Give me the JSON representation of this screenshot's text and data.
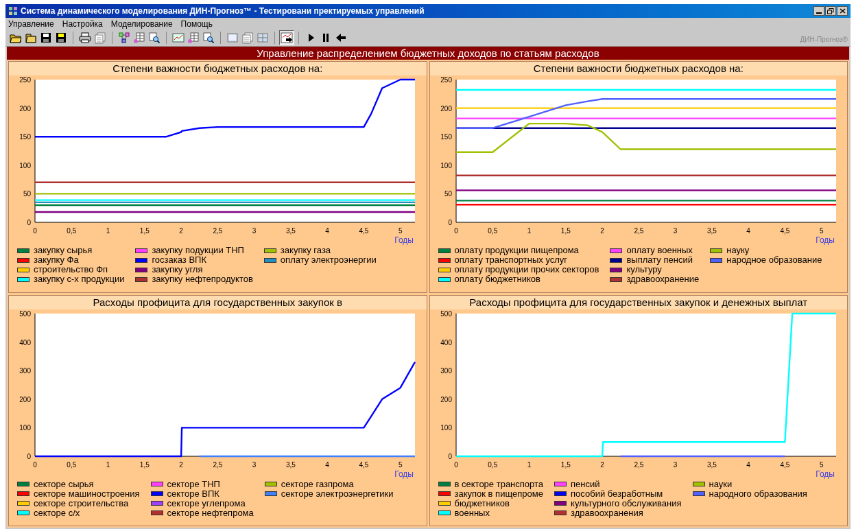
{
  "window": {
    "title": "Система динамического моделирования ДИН-Прогноз™ - Тестировани пректируемых управлений"
  },
  "menu": [
    "Управление",
    "Настройка",
    "Моделирование",
    "Помощь"
  ],
  "toolbar": [
    [
      {
        "kind": "open",
        "pressed": false
      },
      {
        "kind": "folder",
        "pressed": false
      },
      {
        "kind": "save",
        "pressed": false
      },
      {
        "kind": "saveas",
        "pressed": false
      }
    ],
    [
      {
        "kind": "print",
        "pressed": false
      },
      {
        "kind": "page",
        "pressed": false
      }
    ],
    [
      {
        "kind": "diagram",
        "pressed": false
      },
      {
        "kind": "table",
        "pressed": false
      },
      {
        "kind": "zoom",
        "pressed": false
      }
    ],
    [
      {
        "kind": "chart",
        "pressed": false
      },
      {
        "kind": "table",
        "pressed": false
      },
      {
        "kind": "zoom",
        "pressed": false
      }
    ],
    [
      {
        "kind": "window",
        "pressed": false
      },
      {
        "kind": "pages",
        "pressed": false
      },
      {
        "kind": "grid",
        "pressed": false
      }
    ],
    [
      {
        "kind": "run-chart",
        "pressed": true
      }
    ],
    [
      {
        "kind": "play",
        "pressed": false
      },
      {
        "kind": "pause",
        "pressed": false
      },
      {
        "kind": "back",
        "pressed": false
      }
    ]
  ],
  "brand": "ДИН-Прогноз®",
  "header": "Управление распределением бюджетных доходов по статьям расходов",
  "charts": [
    {
      "title": "Степени важности бюджетных расходов на:",
      "chart_data": {
        "type": "line",
        "xlabel": "Годы",
        "x": [
          0,
          0.5,
          1,
          1.5,
          1.8,
          2,
          2.01,
          2.25,
          2.5,
          3,
          3.5,
          4,
          4.5,
          4.6,
          4.75,
          5,
          5.2
        ],
        "xlim": [
          0,
          5.2
        ],
        "ylim": [
          0,
          250
        ],
        "yticks": [
          0,
          50,
          100,
          150,
          200,
          250
        ],
        "xticks": [
          0,
          {
            "value": 0.5,
            "label": "0,5"
          },
          1,
          {
            "value": 1.5,
            "label": "1,5"
          },
          2,
          {
            "value": 2.5,
            "label": "2,5"
          },
          3,
          {
            "value": 3.5,
            "label": "3,5"
          },
          4,
          {
            "value": 4.5,
            "label": "4,5"
          },
          5
        ],
        "series": [
          {
            "name": "закупку сырья",
            "color": "#008040",
            "values": [
              30,
              30,
              30,
              30,
              30,
              30,
              30,
              30,
              30,
              30,
              30,
              30,
              30,
              30,
              30,
              30,
              30
            ]
          },
          {
            "name": "закупку Фа",
            "color": "#ff0000",
            "values": [
              null,
              null,
              null,
              null,
              null,
              null,
              null,
              null,
              null,
              null,
              null,
              null,
              null,
              null,
              null,
              null,
              null
            ]
          },
          {
            "name": "строительство Фп",
            "color": "#ffcc00",
            "values": [
              null,
              null,
              null,
              null,
              null,
              null,
              null,
              null,
              null,
              null,
              null,
              null,
              null,
              null,
              null,
              null,
              null
            ]
          },
          {
            "name": "закупку с-х продукции",
            "color": "#00ffff",
            "values": [
              39,
              39,
              39,
              39,
              39,
              39,
              39,
              39,
              39,
              39,
              39,
              39,
              39,
              39,
              39,
              39,
              39
            ]
          },
          {
            "name": "закупку подукции ТНП",
            "color": "#ff40ff",
            "values": [
              null,
              null,
              null,
              null,
              null,
              null,
              null,
              null,
              null,
              null,
              null,
              null,
              null,
              null,
              null,
              null,
              null
            ]
          },
          {
            "name": "госзаказ ВПК",
            "color": "#0000ff",
            "values": [
              150,
              150,
              150,
              150,
              150,
              158,
              160,
              165,
              167,
              167,
              167,
              167,
              167,
              190,
              235,
              250,
              250
            ]
          },
          {
            "name": "закупку угля",
            "color": "#800080",
            "values": [
              18,
              18,
              18,
              18,
              18,
              18,
              18,
              18,
              18,
              18,
              18,
              18,
              18,
              18,
              18,
              18,
              18
            ]
          },
          {
            "name": "закупку нефтепродуктов",
            "color": "#b03030",
            "values": [
              70,
              70,
              70,
              70,
              70,
              70,
              70,
              70,
              70,
              70,
              70,
              70,
              70,
              70,
              70,
              70,
              70
            ]
          },
          {
            "name": "закупку газа",
            "color": "#a0c000",
            "values": [
              50,
              50,
              50,
              50,
              50,
              50,
              50,
              50,
              50,
              50,
              50,
              50,
              50,
              50,
              50,
              50,
              50
            ]
          },
          {
            "name": "оплату электроэнергии",
            "color": "#2090c0",
            "values": [
              35,
              35,
              35,
              35,
              35,
              35,
              35,
              35,
              35,
              35,
              35,
              35,
              35,
              35,
              35,
              35,
              35
            ]
          }
        ]
      }
    },
    {
      "title": "Степени важности бюджетных расходов на:",
      "chart_data": {
        "type": "line",
        "xlabel": "Годы",
        "x": [
          0,
          0.5,
          1,
          1.5,
          1.8,
          2,
          2.01,
          2.25,
          2.5,
          3,
          3.5,
          4,
          4.5,
          4.6,
          4.75,
          5,
          5.2
        ],
        "xlim": [
          0,
          5.2
        ],
        "ylim": [
          0,
          250
        ],
        "yticks": [
          0,
          50,
          100,
          150,
          200,
          250
        ],
        "xticks": [
          0,
          {
            "value": 0.5,
            "label": "0,5"
          },
          1,
          {
            "value": 1.5,
            "label": "1,5"
          },
          2,
          {
            "value": 2.5,
            "label": "2,5"
          },
          3,
          {
            "value": 3.5,
            "label": "3,5"
          },
          4,
          {
            "value": 4.5,
            "label": "4,5"
          },
          5
        ],
        "series": [
          {
            "name": "оплату продукции пищепрома",
            "color": "#008040",
            "values": [
              38,
              38,
              38,
              38,
              38,
              38,
              38,
              38,
              38,
              38,
              38,
              38,
              38,
              38,
              38,
              38,
              38
            ]
          },
          {
            "name": "оплату транспортных услуг",
            "color": "#ff0000",
            "values": [
              31,
              31,
              31,
              31,
              31,
              31,
              31,
              31,
              31,
              31,
              31,
              31,
              31,
              31,
              31,
              31,
              31
            ]
          },
          {
            "name": "оплату продукции прочих секторов",
            "color": "#ffcc00",
            "values": [
              200,
              200,
              200,
              200,
              200,
              200,
              200,
              200,
              200,
              200,
              200,
              200,
              200,
              200,
              200,
              200,
              200
            ]
          },
          {
            "name": "оплату бюджетников",
            "color": "#00ffff",
            "values": [
              232,
              232,
              232,
              232,
              232,
              232,
              232,
              232,
              232,
              232,
              232,
              232,
              232,
              232,
              232,
              232,
              232
            ]
          },
          {
            "name": "оплату военных",
            "color": "#ff40ff",
            "values": [
              182,
              182,
              182,
              182,
              182,
              182,
              182,
              182,
              182,
              182,
              182,
              182,
              182,
              182,
              182,
              182,
              182
            ]
          },
          {
            "name": "выплату пенсий",
            "color": "#000090",
            "values": [
              165,
              165,
              165,
              165,
              165,
              165,
              165,
              165,
              165,
              165,
              165,
              165,
              165,
              165,
              165,
              165,
              165
            ]
          },
          {
            "name": "культуру",
            "color": "#800080",
            "values": [
              56,
              56,
              56,
              56,
              56,
              56,
              56,
              56,
              56,
              56,
              56,
              56,
              56,
              56,
              56,
              56,
              56
            ]
          },
          {
            "name": "здравоохранение",
            "color": "#b03030",
            "values": [
              82,
              82,
              82,
              82,
              82,
              82,
              82,
              82,
              82,
              82,
              82,
              82,
              82,
              82,
              82,
              82,
              82
            ]
          },
          {
            "name": "науку",
            "color": "#a0c000",
            "values": [
              123,
              123,
              173,
              173,
              170,
              158,
              157,
              128,
              128,
              128,
              128,
              128,
              128,
              128,
              128,
              128,
              128
            ]
          },
          {
            "name": "народное образование",
            "color": "#5060ff",
            "values": [
              165,
              165,
              185,
              205,
              212,
              216,
              216,
              216,
              216,
              216,
              216,
              216,
              216,
              216,
              216,
              216,
              216
            ]
          }
        ]
      }
    },
    {
      "title": "Расходы профицита для государственных закупок в",
      "chart_data": {
        "type": "line",
        "xlabel": "Годы",
        "x": [
          0,
          0.5,
          1,
          1.5,
          1.8,
          2,
          2.01,
          2.25,
          2.5,
          3,
          3.5,
          4,
          4.5,
          4.6,
          4.75,
          5,
          5.2
        ],
        "xlim": [
          0,
          5.2
        ],
        "ylim": [
          0,
          500
        ],
        "yticks": [
          0,
          100,
          200,
          300,
          400,
          500
        ],
        "xticks": [
          0,
          {
            "value": 0.5,
            "label": "0,5"
          },
          1,
          {
            "value": 1.5,
            "label": "1,5"
          },
          2,
          {
            "value": 2.5,
            "label": "2,5"
          },
          3,
          {
            "value": 3.5,
            "label": "3,5"
          },
          4,
          {
            "value": 4.5,
            "label": "4,5"
          },
          5
        ],
        "series": [
          {
            "name": "секторе сырья",
            "color": "#008040",
            "values": [
              null,
              null,
              null,
              null,
              null,
              null,
              null,
              null,
              null,
              null,
              null,
              null,
              null,
              null,
              null,
              null,
              null
            ]
          },
          {
            "name": "секторе машиностроения",
            "color": "#ff0000",
            "values": [
              null,
              null,
              null,
              null,
              null,
              null,
              null,
              null,
              null,
              null,
              null,
              null,
              null,
              null,
              null,
              null,
              null
            ]
          },
          {
            "name": "секторе строительства",
            "color": "#ffcc00",
            "values": [
              null,
              null,
              null,
              null,
              null,
              null,
              null,
              null,
              null,
              null,
              null,
              null,
              null,
              null,
              null,
              null,
              null
            ]
          },
          {
            "name": "секторе с/х",
            "color": "#00ffff",
            "values": [
              null,
              null,
              null,
              null,
              null,
              null,
              null,
              null,
              null,
              null,
              null,
              null,
              null,
              null,
              null,
              null,
              null
            ]
          },
          {
            "name": "секторе ТНП",
            "color": "#ff40ff",
            "values": [
              null,
              null,
              null,
              null,
              null,
              null,
              null,
              null,
              null,
              null,
              null,
              null,
              null,
              null,
              null,
              null,
              null
            ]
          },
          {
            "name": "секторе ВПК",
            "color": "#0000ff",
            "values": [
              0,
              0,
              0,
              0,
              0,
              0,
              100,
              100,
              100,
              100,
              100,
              100,
              100,
              140,
              200,
              240,
              330
            ]
          },
          {
            "name": "секторе углепрома",
            "color": "#a040ff",
            "values": [
              null,
              null,
              null,
              null,
              null,
              null,
              null,
              null,
              null,
              null,
              null,
              null,
              null,
              null,
              null,
              null,
              null
            ]
          },
          {
            "name": "секторе нефтепрома",
            "color": "#b03030",
            "values": [
              null,
              null,
              null,
              null,
              null,
              null,
              null,
              null,
              null,
              null,
              null,
              null,
              null,
              null,
              null,
              null,
              null
            ]
          },
          {
            "name": "секторе газпрома",
            "color": "#a0c000",
            "values": [
              null,
              null,
              null,
              null,
              null,
              null,
              null,
              null,
              null,
              null,
              null,
              null,
              null,
              null,
              null,
              null,
              null
            ]
          },
          {
            "name": "секторе электроэнергетики",
            "color": "#4080ff",
            "values": [
              null,
              null,
              null,
              null,
              null,
              null,
              null,
              0,
              0,
              0,
              0,
              0,
              0,
              0,
              0,
              0,
              0
            ]
          }
        ]
      }
    },
    {
      "title": "Расходы профицита для государственных закупок и денежных выплат",
      "chart_data": {
        "type": "line",
        "xlabel": "Годы",
        "x": [
          0,
          0.5,
          1,
          1.5,
          1.8,
          2,
          2.01,
          2.25,
          2.5,
          3,
          3.5,
          4,
          4.5,
          4.6,
          4.75,
          5,
          5.2
        ],
        "xlim": [
          0,
          5.2
        ],
        "ylim": [
          0,
          500
        ],
        "yticks": [
          0,
          100,
          200,
          300,
          400,
          500
        ],
        "xticks": [
          0,
          {
            "value": 0.5,
            "label": "0,5"
          },
          1,
          {
            "value": 1.5,
            "label": "1,5"
          },
          2,
          {
            "value": 2.5,
            "label": "2,5"
          },
          3,
          {
            "value": 3.5,
            "label": "3,5"
          },
          4,
          {
            "value": 4.5,
            "label": "4,5"
          },
          5
        ],
        "series": [
          {
            "name": "в секторе транспорта",
            "color": "#008040",
            "values": [
              null,
              null,
              null,
              null,
              null,
              null,
              null,
              null,
              null,
              null,
              null,
              null,
              null,
              null,
              null,
              null,
              null
            ]
          },
          {
            "name": "закупок в пищепроме",
            "color": "#ff0000",
            "values": [
              null,
              null,
              null,
              null,
              null,
              null,
              null,
              null,
              null,
              null,
              null,
              null,
              null,
              null,
              null,
              null,
              null
            ]
          },
          {
            "name": "бюджетников",
            "color": "#ffcc00",
            "values": [
              null,
              null,
              null,
              null,
              null,
              null,
              null,
              null,
              null,
              null,
              null,
              null,
              null,
              null,
              null,
              null,
              null
            ]
          },
          {
            "name": "военных",
            "color": "#00ffff",
            "values": [
              0,
              0,
              0,
              0,
              0,
              0,
              50,
              50,
              50,
              50,
              50,
              50,
              50,
              500,
              500,
              500,
              500
            ]
          },
          {
            "name": "пенсий",
            "color": "#ff40ff",
            "values": [
              null,
              null,
              null,
              null,
              null,
              null,
              null,
              null,
              null,
              null,
              null,
              null,
              null,
              null,
              null,
              null,
              null
            ]
          },
          {
            "name": "пособий безработным",
            "color": "#0000ff",
            "values": [
              null,
              null,
              null,
              null,
              null,
              null,
              null,
              null,
              null,
              null,
              null,
              null,
              null,
              null,
              null,
              null,
              null
            ]
          },
          {
            "name": "культурного обслуживания",
            "color": "#800080",
            "values": [
              null,
              null,
              null,
              null,
              null,
              null,
              null,
              null,
              null,
              null,
              null,
              null,
              null,
              null,
              null,
              null,
              null
            ]
          },
          {
            "name": "здравоохранения",
            "color": "#b03030",
            "values": [
              null,
              null,
              null,
              null,
              null,
              null,
              null,
              null,
              null,
              null,
              null,
              null,
              null,
              null,
              null,
              null,
              null
            ]
          },
          {
            "name": "науки",
            "color": "#a0c000",
            "values": [
              null,
              null,
              null,
              null,
              null,
              null,
              null,
              null,
              null,
              null,
              null,
              null,
              null,
              null,
              null,
              null,
              null
            ]
          },
          {
            "name": "народного образования",
            "color": "#5060ff",
            "values": [
              null,
              null,
              null,
              null,
              null,
              null,
              null,
              0,
              0,
              0,
              0,
              0,
              0,
              null,
              null,
              null,
              null
            ]
          }
        ]
      }
    }
  ]
}
